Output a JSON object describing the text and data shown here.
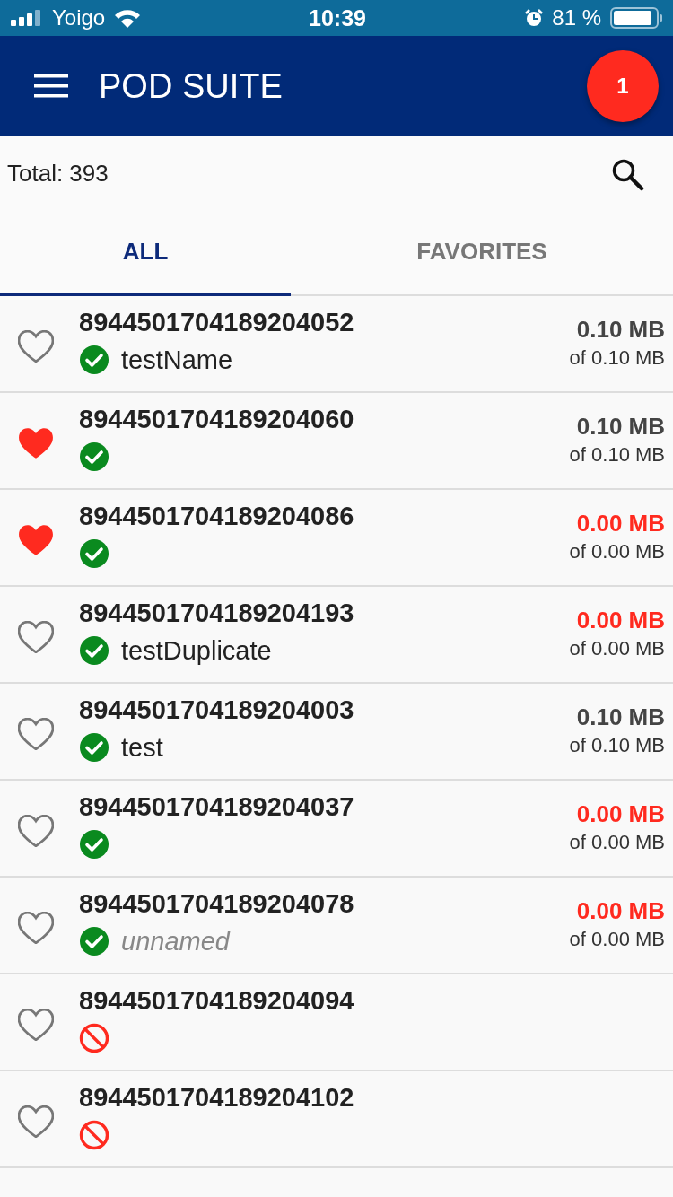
{
  "status_bar": {
    "carrier": "Yoigo",
    "time": "10:39",
    "battery": "81 %"
  },
  "header": {
    "title": "POD SUITE",
    "badge": "1"
  },
  "summary": {
    "total": "Total: 393"
  },
  "tabs": [
    {
      "label": "ALL",
      "selected": true
    },
    {
      "label": "FAVORITES",
      "selected": false
    }
  ],
  "rows": [
    {
      "number": "8944501704189204052",
      "favorite": false,
      "kind": "active",
      "name": "testName",
      "unnamed": false,
      "used": "0.10 MB",
      "total": "of 0.10 MB",
      "exhausted": false
    },
    {
      "number": "8944501704189204060",
      "favorite": true,
      "kind": "active",
      "used": "0.10 MB",
      "total": "of 0.10 MB",
      "exhausted": false
    },
    {
      "number": "8944501704189204086",
      "favorite": true,
      "kind": "active",
      "used": "0.00 MB",
      "total": "of 0.00 MB",
      "exhausted": true
    },
    {
      "number": "8944501704189204193",
      "favorite": false,
      "kind": "active",
      "name": "testDuplicate",
      "unnamed": false,
      "used": "0.00 MB",
      "total": "of 0.00 MB",
      "exhausted": true
    },
    {
      "number": "8944501704189204003",
      "favorite": false,
      "kind": "active",
      "name": "test",
      "unnamed": false,
      "used": "0.10 MB",
      "total": "of 0.10 MB",
      "exhausted": false
    },
    {
      "number": "8944501704189204037",
      "favorite": false,
      "kind": "active",
      "used": "0.00 MB",
      "total": "of 0.00 MB",
      "exhausted": true
    },
    {
      "number": "8944501704189204078",
      "favorite": false,
      "kind": "active",
      "name": "unnamed",
      "unnamed": true,
      "used": "0.00 MB",
      "total": "of 0.00 MB",
      "exhausted": true
    },
    {
      "number": "8944501704189204094",
      "favorite": false,
      "kind": "blocked"
    },
    {
      "number": "8944501704189204102",
      "favorite": false,
      "kind": "blocked"
    }
  ]
}
